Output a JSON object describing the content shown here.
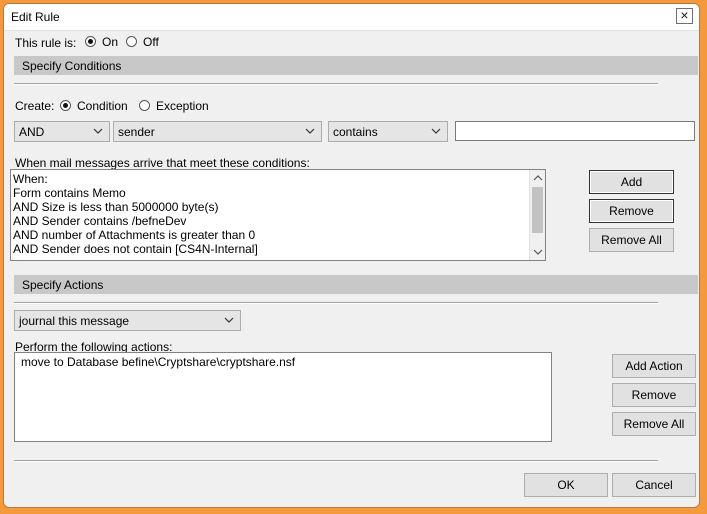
{
  "window": {
    "title": "Edit Rule",
    "close_glyph": "×"
  },
  "status": {
    "label": "This rule is:",
    "on_label": "On",
    "off_label": "Off",
    "selected": "On"
  },
  "conditions": {
    "section_title": "Specify Conditions",
    "create_label": "Create:",
    "condition_label": "Condition",
    "exception_label": "Exception",
    "create_selected": "Condition",
    "operator_value": "AND",
    "field_value": "sender",
    "comparison_value": "contains",
    "value_text": "",
    "list_label": "When mail messages arrive that meet these conditions:",
    "list_items": [
      "When:",
      "Form contains Memo",
      "AND Size  is less than 5000000 byte(s)",
      "AND Sender contains /befneDev",
      "AND number of Attachments is greater than 0",
      "AND Sender does not contain [CS4N-Internal]"
    ],
    "add_label": "Add",
    "remove_label": "Remove",
    "remove_all_label": "Remove All"
  },
  "actions": {
    "section_title": "Specify Actions",
    "action_value": "journal this message",
    "list_label": "Perform the following actions:",
    "list_items": [
      "move to Database befine\\Cryptshare\\cryptshare.nsf"
    ],
    "add_action_label": "Add Action",
    "remove_label": "Remove",
    "remove_all_label": "Remove All"
  },
  "footer": {
    "ok_label": "OK",
    "cancel_label": "Cancel"
  },
  "icons": [
    "close-icon",
    "chevron-down-icon",
    "scroll-up-icon",
    "scroll-down-icon"
  ],
  "colors": {
    "frame": "#f49a3c",
    "dialog": "#f0f0f0",
    "section": "#c8c8c8"
  }
}
